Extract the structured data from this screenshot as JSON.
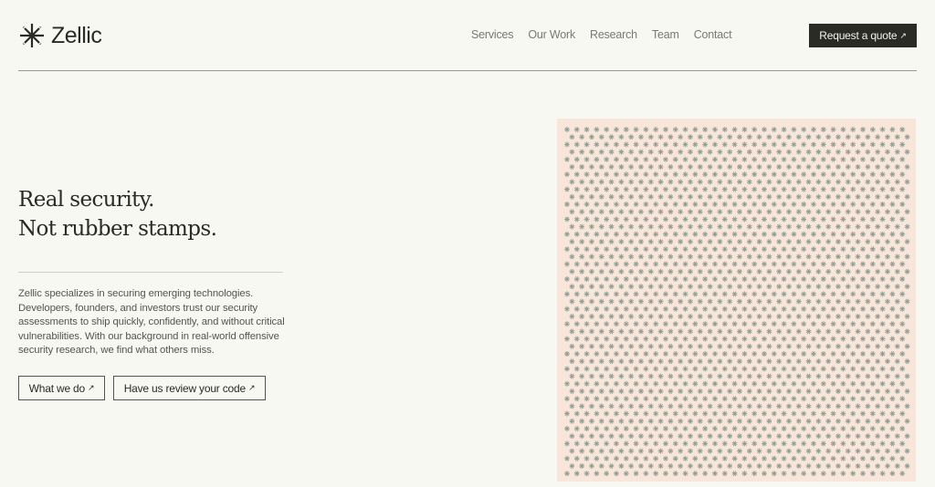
{
  "brand": {
    "name": "Zellic",
    "logo_icon": "zellic-star-icon"
  },
  "nav": {
    "items": [
      {
        "label": "Services"
      },
      {
        "label": "Our Work"
      },
      {
        "label": "Research"
      },
      {
        "label": "Team"
      },
      {
        "label": "Contact"
      }
    ],
    "cta_label": "Request a quote",
    "cta_icon": "arrow-up-right-icon"
  },
  "hero": {
    "headline_line1": "Real security.",
    "headline_line2": "Not rubber stamps.",
    "description": "Zellic specializes in securing emerging technologies. Developers, founders, and investors trust our security assessments to ship quickly, confidently, and without critical vulnerabilities. With our background in real-world offensive security research, we find what others miss.",
    "primary_button": "What we do",
    "secondary_button": "Have us review your code"
  },
  "colors": {
    "background": "#f8f8f3",
    "ink": "#2a2a26",
    "muted": "#7a7a72",
    "pattern_bg": "#f9e6da",
    "pattern_glyph": "#8f9c92"
  }
}
